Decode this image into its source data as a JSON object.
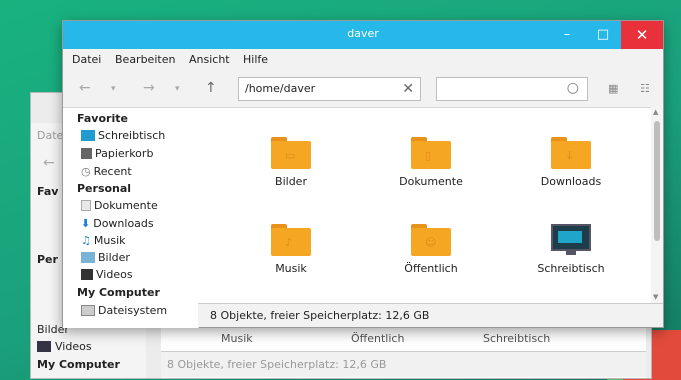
{
  "window": {
    "title": "daver",
    "minimize_glyph": "–",
    "maximize_glyph": "□",
    "close_glyph": "✕"
  },
  "menubar": [
    "Datei",
    "Bearbeiten",
    "Ansicht",
    "Hilfe"
  ],
  "toolbar": {
    "path_value": "/home/daver",
    "search_value": "",
    "icons": [
      "back-icon",
      "forward-icon",
      "up-icon",
      "clear-icon",
      "search-icon",
      "grid-view-icon",
      "list-view-icon"
    ]
  },
  "sidebar": {
    "favorites_heading": "Favorite",
    "favorites": [
      "Schreibtisch",
      "Papierkorb",
      "Recent"
    ],
    "personal_heading": "Personal",
    "personal": [
      "Dokumente",
      "Downloads",
      "Musik",
      "Bilder",
      "Videos"
    ],
    "computer_heading": "My Computer",
    "computer": [
      "Dateisystem"
    ]
  },
  "files": [
    {
      "name": "Bilder",
      "icon": "folder-pictures-icon"
    },
    {
      "name": "Dokumente",
      "icon": "folder-documents-icon"
    },
    {
      "name": "Downloads",
      "icon": "folder-downloads-icon"
    },
    {
      "name": "Musik",
      "icon": "folder-music-icon"
    },
    {
      "name": "Öffentlich",
      "icon": "folder-public-icon"
    },
    {
      "name": "Schreibtisch",
      "icon": "desktop-icon"
    }
  ],
  "status": "8 Objekte, freier Speicherplatz: 12,6 GB",
  "background_window": {
    "menu_fragment": "Date",
    "sidebar_fragments": [
      "Fav",
      "Per",
      "Bilder",
      "Videos",
      "My Computer"
    ],
    "labels": [
      "Musik",
      "Öffentlich",
      "Schreibtisch"
    ],
    "status": "8 Objekte, freier Speicherplatz: 12,6 GB"
  },
  "colors": {
    "titlebar": "#27b8ea",
    "close": "#e8313b",
    "folder": "#f5a623",
    "desktop": "#1fa57f"
  }
}
